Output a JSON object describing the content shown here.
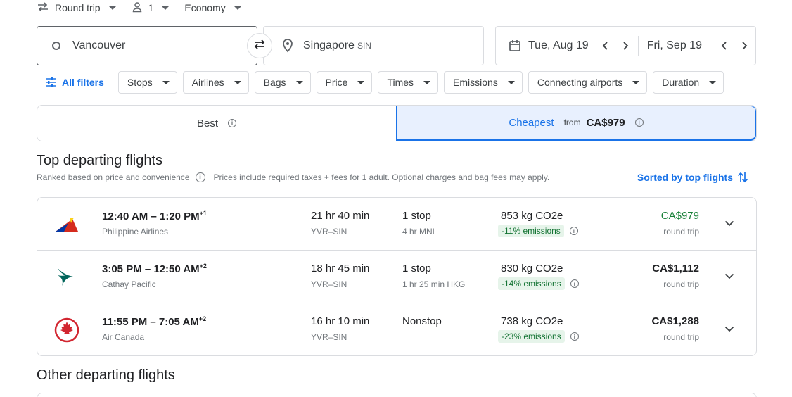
{
  "trip": {
    "type_label": "Round trip",
    "passengers": "1",
    "cabin": "Economy"
  },
  "search": {
    "origin": "Vancouver",
    "destination": "Singapore",
    "destination_code": "SIN",
    "depart_date": "Tue, Aug 19",
    "return_date": "Fri, Sep 19"
  },
  "filters": {
    "all_filters": "All filters",
    "chips": [
      "Stops",
      "Airlines",
      "Bags",
      "Price",
      "Times",
      "Emissions",
      "Connecting airports",
      "Duration"
    ]
  },
  "tabs": {
    "best": "Best",
    "cheapest": "Cheapest",
    "cheapest_from": "from",
    "cheapest_price": "CA$979"
  },
  "section": {
    "title": "Top departing flights",
    "ranked": "Ranked based on price and convenience",
    "note": "Prices include required taxes + fees for 1 adult. Optional charges and bag fees may apply.",
    "sorted": "Sorted by top flights",
    "other_title": "Other departing flights"
  },
  "flights": [
    {
      "times": "12:40 AM – 1:20 PM",
      "day_offset": "+1",
      "airline": "Philippine Airlines",
      "duration": "21 hr 40 min",
      "route": "YVR–SIN",
      "stops": "1 stop",
      "stop_detail": "4 hr MNL",
      "co2": "853 kg CO2e",
      "emissions": "-11% emissions",
      "price": "CA$979",
      "price_type": "round trip",
      "logo": "philippine-airlines-logo"
    },
    {
      "times": "3:05 PM – 12:50 AM",
      "day_offset": "+2",
      "airline": "Cathay Pacific",
      "duration": "18 hr 45 min",
      "route": "YVR–SIN",
      "stops": "1 stop",
      "stop_detail": "1 hr 25 min HKG",
      "co2": "830 kg CO2e",
      "emissions": "-14% emissions",
      "price": "CA$1,112",
      "price_type": "round trip",
      "logo": "cathay-pacific-logo"
    },
    {
      "times": "11:55 PM – 7:05 AM",
      "day_offset": "+2",
      "airline": "Air Canada",
      "duration": "16 hr 10 min",
      "route": "YVR–SIN",
      "stops": "Nonstop",
      "stop_detail": "",
      "co2": "738 kg CO2e",
      "emissions": "-23% emissions",
      "price": "CA$1,288",
      "price_type": "round trip",
      "logo": "air-canada-logo"
    }
  ],
  "colors": {
    "accent": "#1a73e8",
    "cheap_price": "#188038",
    "emission_bg": "#e6f4ea",
    "emission_text": "#137333"
  }
}
